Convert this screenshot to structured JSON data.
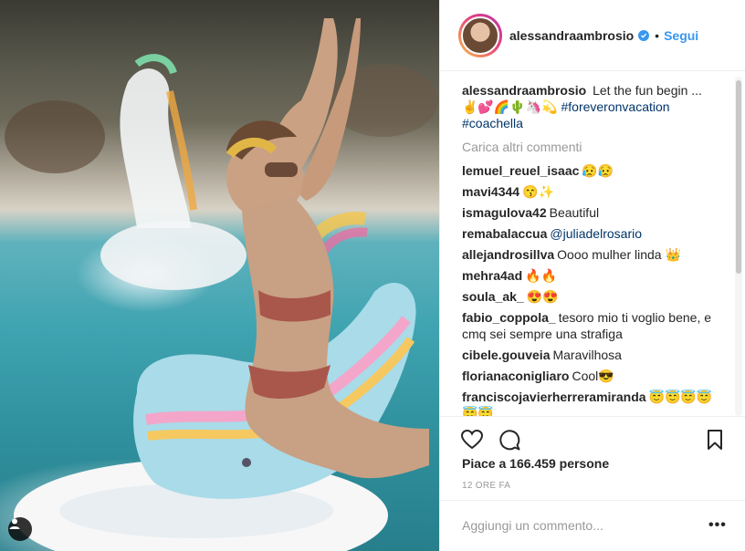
{
  "post": {
    "author": "alessandraambrosio",
    "follow_label": "Segui",
    "bullet": "•",
    "caption_text": "Let the fun begin ...",
    "caption_emojis": "✌️💕🌈🌵🦄💫",
    "hashtags": [
      "#foreveronvacation",
      "#coachella"
    ],
    "load_more": "Carica altri commenti",
    "likes": "Piace a 166.459 persone",
    "time": "12 ORE FA",
    "comment_placeholder": "Aggiungi un commento...",
    "more_label": "•••"
  },
  "comments": [
    {
      "user": "lemuel_reuel_isaac",
      "text": "😥😥"
    },
    {
      "user": "mavi4344",
      "text": "😙✨"
    },
    {
      "user": "ismagulova42",
      "text": "Beautiful"
    },
    {
      "user": "remabalaccua",
      "text": "@juliadelrosario",
      "mention": true
    },
    {
      "user": "allejandrosillva",
      "text": "Oooo mulher linda 👑"
    },
    {
      "user": "mehra4ad",
      "text": "🔥🔥"
    },
    {
      "user": "soula_ak_",
      "text": "😍😍"
    },
    {
      "user": "fabio_coppola_",
      "text": "tesoro mio ti voglio bene, e cmq sei sempre una strafiga"
    },
    {
      "user": "cibele.gouveia",
      "text": "Maravilhosa"
    },
    {
      "user": "florianaconigliaro",
      "text": "Cool😎"
    },
    {
      "user": "franciscojavierherreramiranda",
      "text": "😇😇😇😇😇😇"
    }
  ],
  "icons": [
    "user-tag-icon",
    "verified-icon",
    "heart-icon",
    "comment-icon",
    "bookmark-icon"
  ],
  "colors": {
    "link": "#3897f0",
    "hashtag": "#003569",
    "muted": "#999999"
  }
}
